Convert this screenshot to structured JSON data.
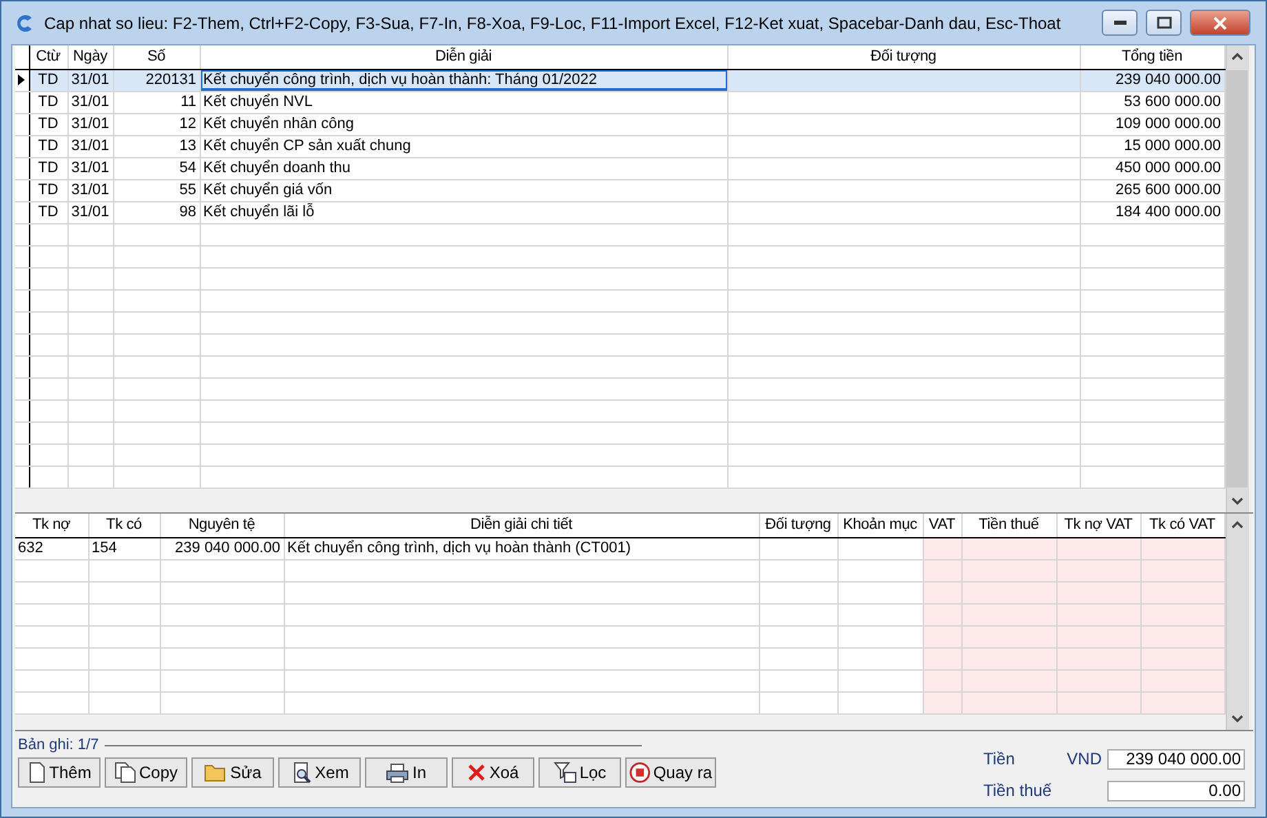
{
  "window": {
    "title": "Cap nhat so lieu: F2-Them, Ctrl+F2-Copy, F3-Sua, F7-In, F8-Xoa, F9-Loc, F11-Import Excel, F12-Ket xuat, Spacebar-Danh dau, Esc-Thoat"
  },
  "main_grid": {
    "columns": [
      "Ctừ",
      "Ngày",
      "Số",
      "Diễn giải",
      "Đối tượng",
      "Tổng tiền"
    ],
    "rows": [
      {
        "selected": true,
        "cells": [
          "TD",
          "31/01",
          "220131",
          "Kết chuyển công trình, dịch vụ hoàn thành: Tháng 01/2022",
          "",
          "239 040 000.00"
        ]
      },
      {
        "selected": false,
        "cells": [
          "TD",
          "31/01",
          "11",
          "Kết chuyển NVL",
          "",
          "53 600 000.00"
        ]
      },
      {
        "selected": false,
        "cells": [
          "TD",
          "31/01",
          "12",
          "Kết chuyển nhân công",
          "",
          "109 000 000.00"
        ]
      },
      {
        "selected": false,
        "cells": [
          "TD",
          "31/01",
          "13",
          "Kết chuyển CP sản xuất chung",
          "",
          "15 000 000.00"
        ]
      },
      {
        "selected": false,
        "cells": [
          "TD",
          "31/01",
          "54",
          "Kết chuyển doanh thu",
          "",
          "450 000 000.00"
        ]
      },
      {
        "selected": false,
        "cells": [
          "TD",
          "31/01",
          "55",
          "Kết chuyển giá vốn",
          "",
          "265 600 000.00"
        ]
      },
      {
        "selected": false,
        "cells": [
          "TD",
          "31/01",
          "98",
          "Kết chuyển lãi lỗ",
          "",
          "184 400 000.00"
        ]
      }
    ]
  },
  "detail_grid": {
    "columns": [
      "Tk nợ",
      "Tk có",
      "Nguyên tệ",
      "Diễn giải chi tiết",
      "Đối tượng",
      "Khoản mục",
      "VAT",
      "Tiền thuế",
      "Tk nợ VAT",
      "Tk có VAT"
    ],
    "rows": [
      {
        "cells": [
          "632",
          "154",
          "239 040 000.00",
          "Kết chuyển công trình, dịch vụ hoàn thành (CT001)",
          "",
          "",
          "",
          "",
          "",
          ""
        ]
      }
    ]
  },
  "record_label": "Bản ghi: 1/7",
  "buttons": [
    {
      "kind": "new",
      "label": "Thêm"
    },
    {
      "kind": "copy",
      "label": "Copy"
    },
    {
      "kind": "edit",
      "label": "Sửa"
    },
    {
      "kind": "view",
      "label": "Xem"
    },
    {
      "kind": "print",
      "label": "In"
    },
    {
      "kind": "delete",
      "label": "Xoá"
    },
    {
      "kind": "filter",
      "label": "Lọc"
    },
    {
      "kind": "exit",
      "label": "Quay ra"
    }
  ],
  "totals": [
    {
      "label": "Tiền",
      "currency": "VND",
      "value": "239 040 000.00"
    },
    {
      "label": "Tiền thuế",
      "value": "0.00"
    }
  ]
}
